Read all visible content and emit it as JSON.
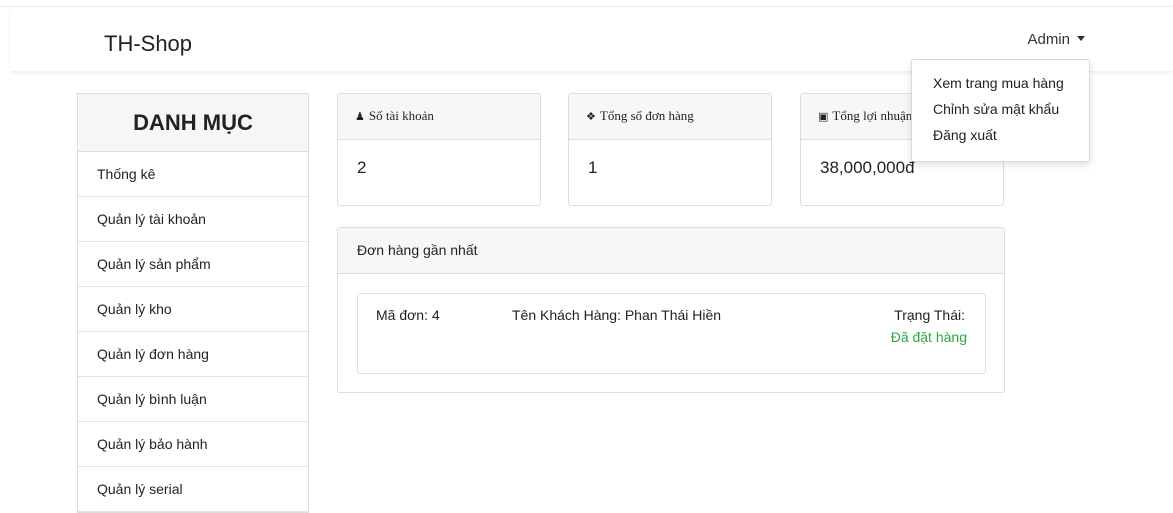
{
  "navbar": {
    "brand": "TH-Shop",
    "user_label": "Admin"
  },
  "user_menu": {
    "items": [
      "Xem trang mua hàng",
      "Chỉnh sửa mật khẩu",
      "Đăng xuất"
    ]
  },
  "sidebar": {
    "title": "DANH MỤC",
    "items": [
      "Thống kê",
      "Quản lý tài khoản",
      "Quản lý sản phẩm",
      "Quản lý kho",
      "Quản lý đơn hàng",
      "Quản lý bình luận",
      "Quản lý bảo hành",
      "Quản lý serial"
    ]
  },
  "stats": [
    {
      "icon": "user-icon",
      "label": "Số tài khoản",
      "value": "2"
    },
    {
      "icon": "dropbox-icon",
      "label": "Tổng số đơn hàng",
      "value": "1"
    },
    {
      "icon": "money-icon",
      "label": "Tổng lợi nhuận",
      "value": "38,000,000đ"
    }
  ],
  "recent_orders": {
    "title": "Đơn hàng gần nhất",
    "order": {
      "id_text": "Mã đơn: 4",
      "customer_text": "Tên Khách Hàng: Phan Thái Hiền",
      "status_label": "Trạng Thái:",
      "status_value": "Đã đặt hàng"
    }
  },
  "colors": {
    "status": "#28a745"
  }
}
